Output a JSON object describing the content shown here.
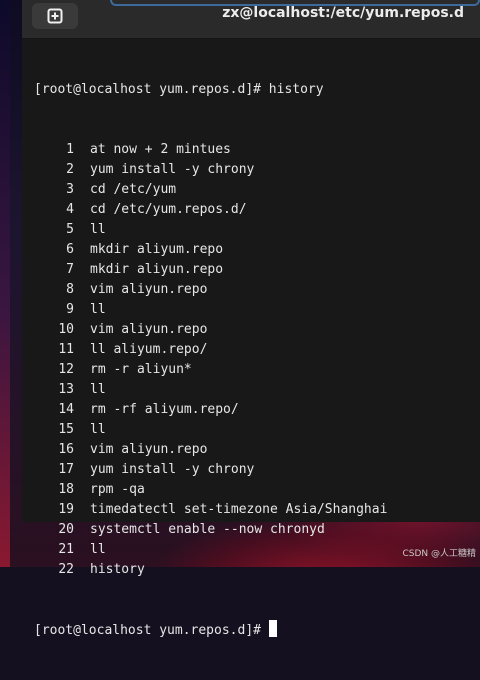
{
  "window": {
    "title": "zx@localhost:/etc/yum.repos.d",
    "new_tab_icon": "plus-square-icon"
  },
  "terminal": {
    "first_prompt": "[root@localhost yum.repos.d]# history",
    "history": [
      {
        "num": "1",
        "cmd": "at now + 2 mintues"
      },
      {
        "num": "2",
        "cmd": "yum install -y chrony"
      },
      {
        "num": "3",
        "cmd": "cd /etc/yum"
      },
      {
        "num": "4",
        "cmd": "cd /etc/yum.repos.d/"
      },
      {
        "num": "5",
        "cmd": "ll"
      },
      {
        "num": "6",
        "cmd": "mkdir aliyum.repo"
      },
      {
        "num": "7",
        "cmd": "mkdir aliyun.repo"
      },
      {
        "num": "8",
        "cmd": "vim aliyun.repo"
      },
      {
        "num": "9",
        "cmd": "ll"
      },
      {
        "num": "10",
        "cmd": "vim aliyun.repo"
      },
      {
        "num": "11",
        "cmd": "ll aliyum.repo/"
      },
      {
        "num": "12",
        "cmd": "rm -r aliyun*"
      },
      {
        "num": "13",
        "cmd": "ll"
      },
      {
        "num": "14",
        "cmd": "rm -rf aliyum.repo/"
      },
      {
        "num": "15",
        "cmd": "ll"
      },
      {
        "num": "16",
        "cmd": "vim aliyun.repo"
      },
      {
        "num": "17",
        "cmd": "yum install -y chrony"
      },
      {
        "num": "18",
        "cmd": "rpm -qa"
      },
      {
        "num": "19",
        "cmd": "timedatectl set-timezone Asia/Shanghai"
      },
      {
        "num": "20",
        "cmd": "systemctl enable --now chronyd"
      },
      {
        "num": "21",
        "cmd": "ll"
      },
      {
        "num": "22",
        "cmd": "history"
      }
    ],
    "last_prompt": "[root@localhost yum.repos.d]#"
  },
  "watermark": "CSDN @人工糖精",
  "colors": {
    "terminal_bg": "#181818",
    "headerbar_bg": "#2a2a2a",
    "text": "#e6e6e6",
    "accent": "#3d6a9a"
  }
}
